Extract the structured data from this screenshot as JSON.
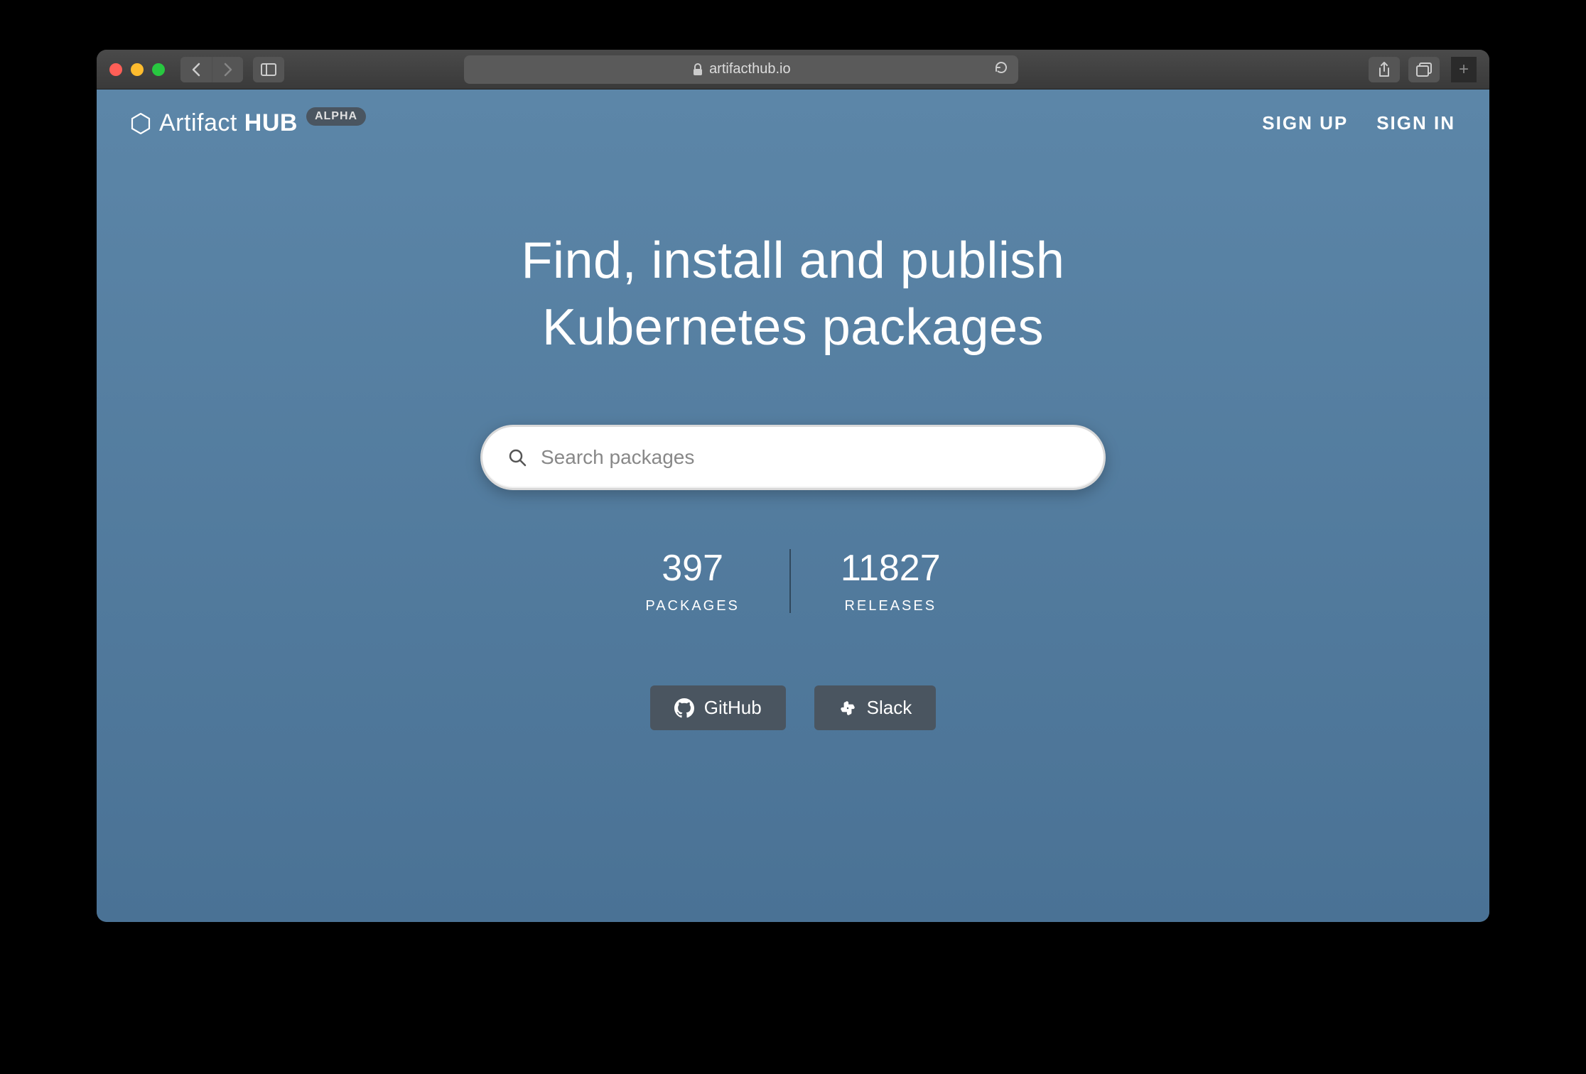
{
  "browser": {
    "url": "artifacthub.io"
  },
  "header": {
    "brand_light": "Artifact",
    "brand_bold": "HUB",
    "badge": "ALPHA",
    "signup": "SIGN UP",
    "signin": "SIGN IN"
  },
  "hero": {
    "title_line1": "Find, install and publish",
    "title_line2": "Kubernetes packages"
  },
  "search": {
    "placeholder": "Search packages"
  },
  "stats": {
    "packages_value": "397",
    "packages_label": "PACKAGES",
    "releases_value": "11827",
    "releases_label": "RELEASES"
  },
  "social": {
    "github": "GitHub",
    "slack": "Slack"
  }
}
